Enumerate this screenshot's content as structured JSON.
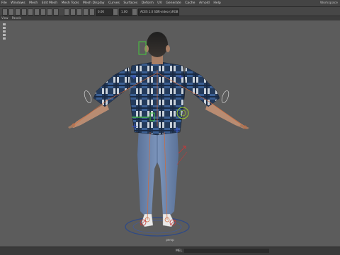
{
  "menubar": {
    "items": [
      "File",
      "Windows",
      "Mesh",
      "Edit Mesh",
      "Mesh Tools",
      "Mesh Display",
      "Curves",
      "Surfaces",
      "Deform",
      "UV",
      "Generate",
      "Cache",
      "Arnold",
      "Help"
    ],
    "workspace": "Workspace"
  },
  "toolbar": {
    "start_field": "0.00",
    "end_field": "1.00",
    "renderer_label": "ACES 1.0 SDR-video (sRGB)"
  },
  "panel_menu": {
    "items": [
      "View",
      "Panels"
    ]
  },
  "viewport": {
    "camera_label": "persp",
    "background": "#5c5c5c"
  },
  "statusbar": {
    "mel_label": "MEL"
  },
  "colors": {
    "shirt_dark": "#243b5c",
    "shirt_light": "#c9d1da",
    "jeans": "#6d86ad",
    "skin": "#b98c72",
    "skeleton": "#d26a39"
  }
}
